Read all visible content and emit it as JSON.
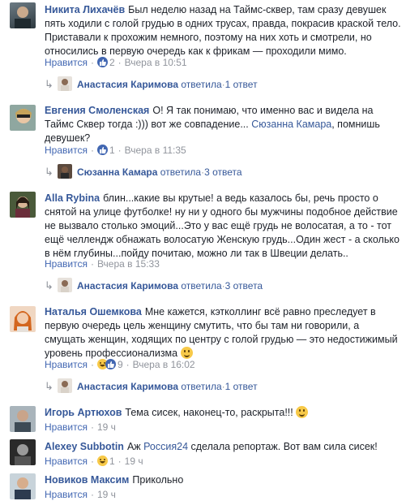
{
  "comments": [
    {
      "author": "Никита Лихачёв",
      "text": "Был неделю назад на Таймс-сквер, там сразу девушек пять ходили с голой грудью в одних трусах, правда, покрасив краской тело. Приставали к прохожим немного, поэтому на них хоть и смотрели, но относились в первую очередь как к фрикам — проходили мимо.",
      "like_label": "Нравится",
      "reactions": "2",
      "time": "Вчера в 10:51",
      "reply": {
        "name": "Анастасия Каримова",
        "action": "ответила",
        "count": "1 ответ"
      }
    },
    {
      "author": "Евгения Смоленская",
      "text_before": "О! Я так понимаю, что именно вас и видела на Таймс Сквер тогда :))) вот же совпадение... ",
      "mention": "Сюзанна Камара",
      "text_after": ", помнишь девушек?",
      "like_label": "Нравится",
      "reactions": "1",
      "time": "Вчера в 11:35",
      "reply": {
        "name": "Сюзанна Камара",
        "action": "ответила",
        "count": "3 ответа"
      }
    },
    {
      "author": "Alla Rybina",
      "text": "блин...какие вы крутые! а ведь казалось бы, речь просто о снятой на улице футболке! ну ни у одного бы мужчины подобное действие не вызвало столько эмоций...Это у вас ещё грудь не волосатая, а то - тот ещё челлендж обнажать волосатую Женскую грудь...Один жест - а сколько в нём глубины...пойду почитаю, можно ли так в Швеции делать..",
      "like_label": "Нравится",
      "time": "Вчера в 15:33",
      "reply": {
        "name": "Анастасия Каримова",
        "action": "ответила",
        "count": "3 ответа"
      }
    },
    {
      "author": "Наталья Ошемкова",
      "text": "Мне кажется, кэтколлинг всё равно преследует в первую очередь цель женщину смутить, что бы там ни говорили, а смущать женщин, ходящих по центру с голой грудью — это недостижимый уровень профессионализма",
      "like_label": "Нравится",
      "reactions": "9",
      "time": "Вчера в 16:02",
      "reply": {
        "name": "Анастасия Каримова",
        "action": "ответила",
        "count": "1 ответ"
      }
    },
    {
      "author": "Игорь Артюхов",
      "text": "Тема сисек, наконец-то, раскрыта!!!",
      "like_label": "Нравится",
      "time": "19 ч"
    },
    {
      "author": "Alexey Subbotin",
      "text_before": "Аж ",
      "mention": "Россия24",
      "text_after": " сделала репортаж. Вот вам сила сисек!",
      "like_label": "Нравится",
      "reactions": "1",
      "time": "19 ч"
    },
    {
      "author": "Новиков Максим",
      "text": "Прикольно",
      "like_label": "Нравится",
      "time": "19 ч"
    }
  ],
  "separator": "·",
  "icons": {
    "like": "thumbs-up-icon",
    "haha": "haha-icon",
    "reply_arrow": "reply-arrow-icon",
    "smile": "smile-emoji-icon"
  },
  "colors": {
    "link": "#365899",
    "meta": "#90949c",
    "like_blue": "#4267b2"
  }
}
